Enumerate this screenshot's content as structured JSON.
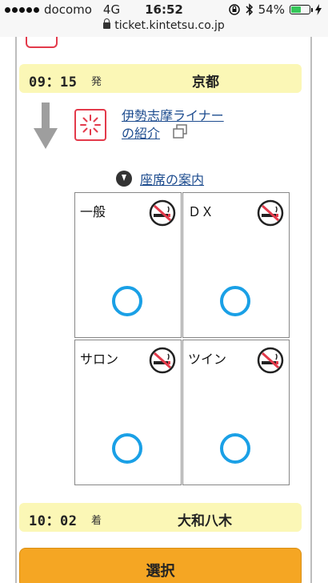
{
  "status_bar": {
    "carrier": "docomo",
    "network": "4G",
    "time": "16:52",
    "battery": "54%",
    "battery_level": 0.54
  },
  "url_bar": {
    "url": "ticket.kintetsu.co.jp"
  },
  "departure": {
    "time": "09：15",
    "suffix": "発",
    "station": "京都"
  },
  "train_info": {
    "line1": "伊勢志摩ライナー",
    "line2": "の紹介"
  },
  "seat_guide": {
    "label": "座席の案内"
  },
  "seats": [
    {
      "label": "一般",
      "available": true
    },
    {
      "label": "ＤＸ",
      "available": true
    },
    {
      "label": "サロン",
      "available": true
    },
    {
      "label": "ツイン",
      "available": true
    }
  ],
  "arrival": {
    "time": "10：02",
    "suffix": "着",
    "station": "大和八木"
  },
  "select_button": {
    "label": "選択"
  },
  "colors": {
    "accent": "#f5a623",
    "station_bg": "#fbf7b6",
    "link": "#1d4c8f",
    "available": "#1aa0e6",
    "logo_red": "#e33a4b"
  }
}
